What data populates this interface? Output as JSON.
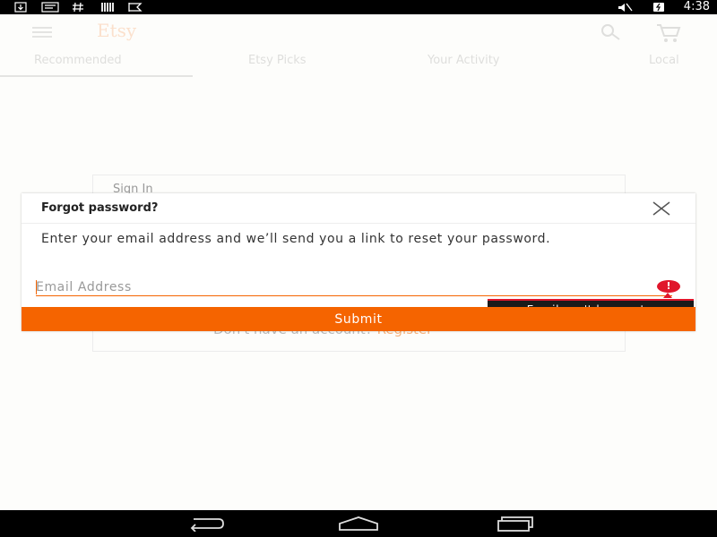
{
  "status_bar": {
    "time": "4:38",
    "icons": [
      "download-icon",
      "message-icon",
      "hashtag-icon",
      "barcode-icon",
      "flag-icon",
      "mute-icon",
      "battery-icon"
    ]
  },
  "app_bar": {
    "logo": "Etsy",
    "icons": [
      "hamburger-menu-icon",
      "search-icon",
      "cart-icon"
    ]
  },
  "tabs": [
    {
      "label": "Recommended"
    },
    {
      "label": "Etsy Picks"
    },
    {
      "label": "Your Activity"
    },
    {
      "label": "Local"
    }
  ],
  "signin": {
    "title": "Sign In",
    "no_account_text": "Don't have an account?",
    "register_link": "Register"
  },
  "dialog": {
    "title": "Forgot password?",
    "message": "Enter your email address and we’ll send you a link to reset your password.",
    "email": {
      "value": "",
      "placeholder": "Email Address"
    },
    "error_text": "Email can't be empty.",
    "submit_label": "Submit"
  },
  "colors": {
    "accent": "#f56400",
    "error": "#e0162b",
    "tooltip_bg": "#1a1a1a"
  }
}
